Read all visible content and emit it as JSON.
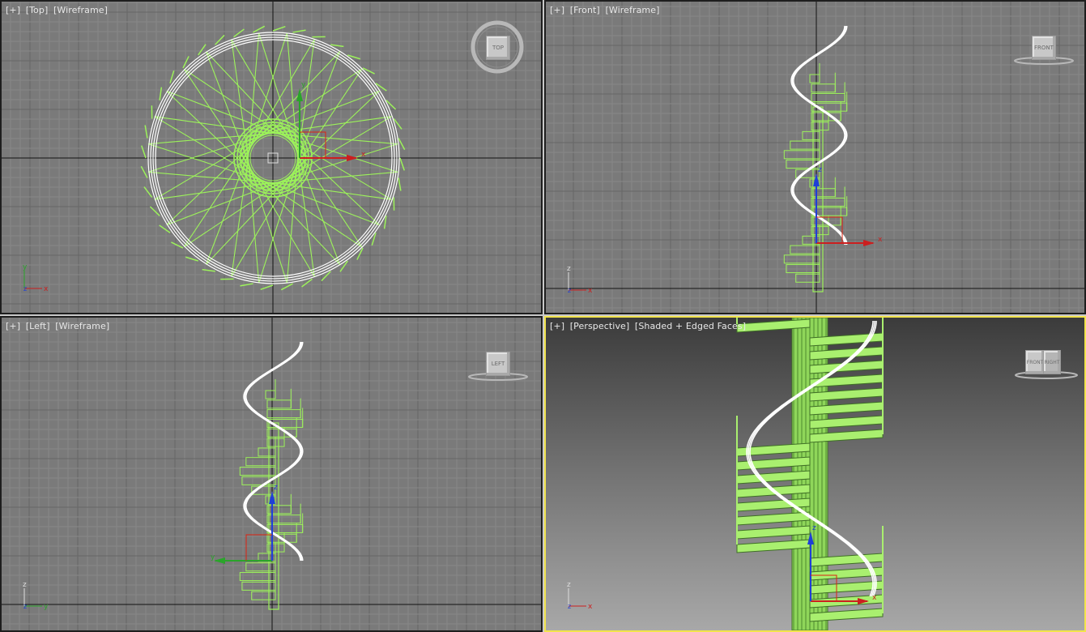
{
  "viewports": {
    "top": {
      "plus": "[+]",
      "view": "[Top]",
      "shading": "[Wireframe]",
      "cube": "TOP"
    },
    "front": {
      "plus": "[+]",
      "view": "[Front]",
      "shading": "[Wireframe]",
      "cube": "FRONT"
    },
    "left": {
      "plus": "[+]",
      "view": "[Left]",
      "shading": "[Wireframe]",
      "cube": "LEFT"
    },
    "persp": {
      "plus": "[+]",
      "view": "[Perspective]",
      "shading": "[Shaded + Edged Faces]",
      "cube_a": "FRONT",
      "cube_b": "RIGHT"
    }
  },
  "axes": {
    "x": "x",
    "y": "y",
    "z": "z"
  },
  "colors": {
    "viewport_bg": "#7a7a7a",
    "grid_minor": "#888888",
    "grid_major": "#666666",
    "stair_green": "#9cf25a",
    "rail_white": "#ffffff",
    "active_border": "#f2e44c",
    "axis_x": "#cc1f1f",
    "axis_y": "#2aa52a",
    "axis_z": "#1f3fd8"
  },
  "icons": [
    "viewcube-icon",
    "axis-tripod-icon",
    "transform-gizmo-icon"
  ]
}
